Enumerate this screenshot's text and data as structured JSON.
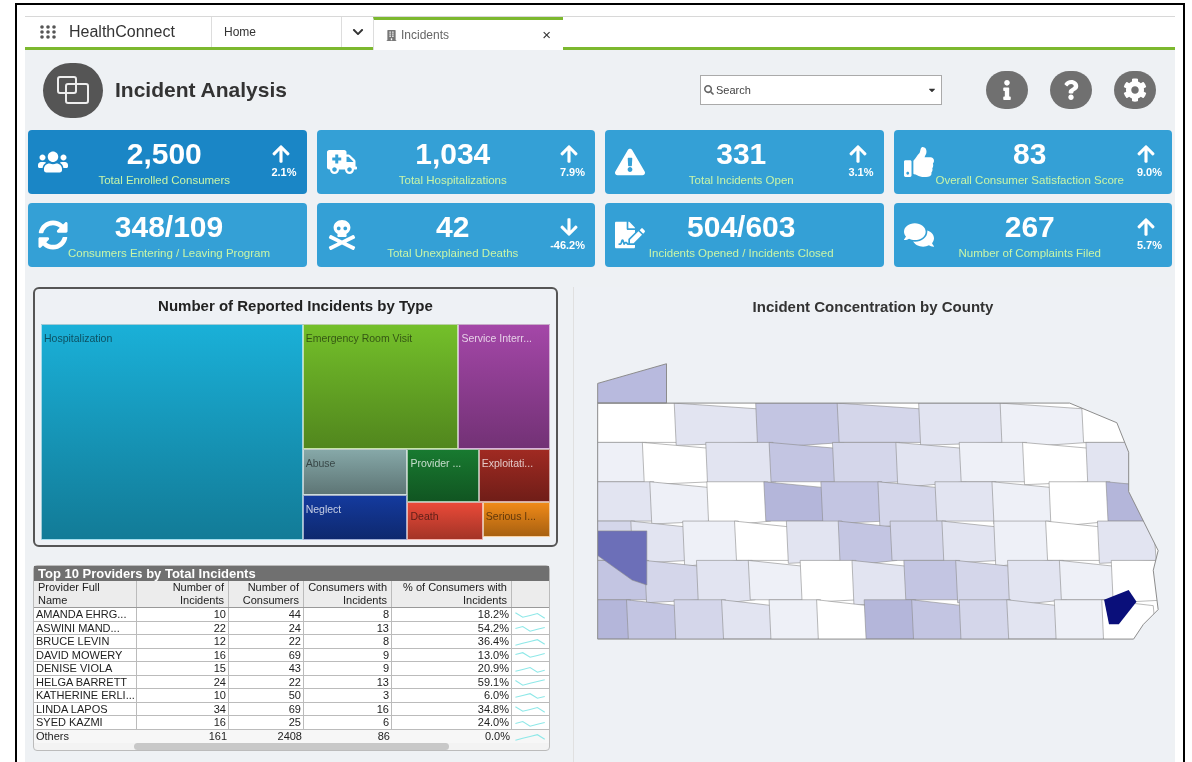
{
  "app": {
    "name": "HealthConnect"
  },
  "tabs": [
    {
      "label": "Home",
      "selected": false
    },
    {
      "label": "Incidents",
      "selected": true
    }
  ],
  "tab_close": "×",
  "page": {
    "title": "Incident Analysis"
  },
  "search": {
    "placeholder": "Search"
  },
  "kpis": [
    {
      "kind": "people",
      "value": "2,500",
      "label": "Total Enrolled Consumers",
      "change": "2.1%",
      "rising": true,
      "selected": true
    },
    {
      "kind": "ambulance",
      "value": "1,034",
      "label": "Total Hospitalizations",
      "change": "7.9%",
      "rising": true,
      "selected": false
    },
    {
      "kind": "warning",
      "value": "331",
      "label": "Total Incidents Open",
      "change": "3.1%",
      "rising": true,
      "selected": false
    },
    {
      "kind": "thumbs",
      "value": "83",
      "label": "Overall Consumer Satisfaction Score",
      "change": "9.0%",
      "rising": true,
      "selected": false
    },
    {
      "kind": "cycle",
      "value": "348/109",
      "label": "Consumers Entering / Leaving Program",
      "selected": false
    },
    {
      "kind": "skull",
      "value": "42",
      "label": "Total Unexplained Deaths",
      "change": "-46.2%",
      "rising": false,
      "selected": false
    },
    {
      "kind": "sign",
      "value": "504/603",
      "label": "Incidents Opened / Incidents Closed",
      "selected": false
    },
    {
      "kind": "chat",
      "value": "267",
      "label": "Number of Complaints Filed",
      "change": "5.7%",
      "rising": true,
      "selected": false
    }
  ],
  "treemap": {
    "title": "Number of Reported Incidents by Type",
    "tiles": [
      {
        "label": "Hospitalization",
        "color": "#1ab0d8"
      },
      {
        "label": "Emergency Room Visit",
        "color": "#74c02a"
      },
      {
        "label": "Service Interr...",
        "color": "#a447a8"
      },
      {
        "label": "Abuse",
        "color": "#86a8a8"
      },
      {
        "label": "Neglect",
        "color": "#143a9e"
      },
      {
        "label": "Provider ...",
        "color": "#187a30"
      },
      {
        "label": "Exploitati...",
        "color": "#a02a22"
      },
      {
        "label": "Death",
        "color": "#ea4a38"
      },
      {
        "label": "Serious I...",
        "color": "#f08a18"
      }
    ]
  },
  "table": {
    "title": "Top 10 Providers by Total Incidents",
    "columns": [
      "Provider Full Name",
      "Number of Incidents",
      "Number of Consumers",
      "Consumers with Incidents",
      "% of Consumers with Incidents"
    ],
    "rows": [
      [
        "AMANDA EHRG...",
        "10",
        "44",
        "8",
        "18.2%"
      ],
      [
        "ASWINI MAND...",
        "22",
        "24",
        "13",
        "54.2%"
      ],
      [
        "BRUCE LEVIN",
        "12",
        "22",
        "8",
        "36.4%"
      ],
      [
        "DAVID MOWERY",
        "16",
        "69",
        "9",
        "13.0%"
      ],
      [
        "DENISE VIOLA",
        "15",
        "43",
        "9",
        "20.9%"
      ],
      [
        "HELGA BARRETT",
        "24",
        "22",
        "13",
        "59.1%"
      ],
      [
        "KATHERINE ERLI...",
        "10",
        "50",
        "3",
        "6.0%"
      ],
      [
        "LINDA LAPOS",
        "34",
        "69",
        "16",
        "34.8%"
      ],
      [
        "SYED KAZMI",
        "16",
        "25",
        "6",
        "24.0%"
      ]
    ],
    "total": [
      "Others",
      "161",
      "2408",
      "86",
      "0.0%"
    ]
  },
  "map": {
    "title": "Incident Concentration by County"
  }
}
